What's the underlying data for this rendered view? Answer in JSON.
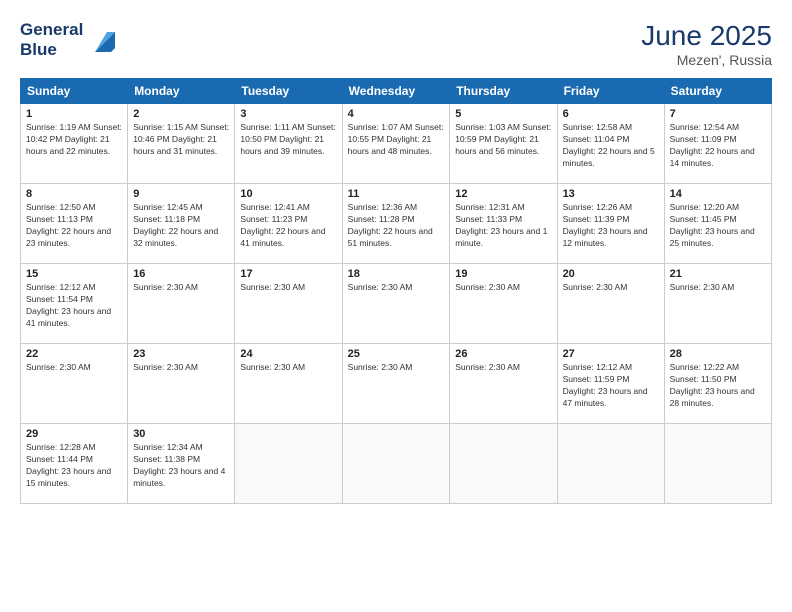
{
  "header": {
    "logo_line1": "General",
    "logo_line2": "Blue",
    "month_year": "June 2025",
    "location": "Mezen', Russia"
  },
  "weekdays": [
    "Sunday",
    "Monday",
    "Tuesday",
    "Wednesday",
    "Thursday",
    "Friday",
    "Saturday"
  ],
  "weeks": [
    [
      {
        "day": "1",
        "info": "Sunrise: 1:19 AM\nSunset: 10:42 PM\nDaylight: 21 hours\nand 22 minutes."
      },
      {
        "day": "2",
        "info": "Sunrise: 1:15 AM\nSunset: 10:46 PM\nDaylight: 21 hours\nand 31 minutes."
      },
      {
        "day": "3",
        "info": "Sunrise: 1:11 AM\nSunset: 10:50 PM\nDaylight: 21 hours\nand 39 minutes."
      },
      {
        "day": "4",
        "info": "Sunrise: 1:07 AM\nSunset: 10:55 PM\nDaylight: 21 hours\nand 48 minutes."
      },
      {
        "day": "5",
        "info": "Sunrise: 1:03 AM\nSunset: 10:59 PM\nDaylight: 21 hours\nand 56 minutes."
      },
      {
        "day": "6",
        "info": "Sunrise: 12:58 AM\nSunset: 11:04 PM\nDaylight: 22 hours\nand 5 minutes."
      },
      {
        "day": "7",
        "info": "Sunrise: 12:54 AM\nSunset: 11:09 PM\nDaylight: 22 hours\nand 14 minutes."
      }
    ],
    [
      {
        "day": "8",
        "info": "Sunrise: 12:50 AM\nSunset: 11:13 PM\nDaylight: 22 hours\nand 23 minutes."
      },
      {
        "day": "9",
        "info": "Sunrise: 12:45 AM\nSunset: 11:18 PM\nDaylight: 22 hours\nand 32 minutes."
      },
      {
        "day": "10",
        "info": "Sunrise: 12:41 AM\nSunset: 11:23 PM\nDaylight: 22 hours\nand 41 minutes."
      },
      {
        "day": "11",
        "info": "Sunrise: 12:36 AM\nSunset: 11:28 PM\nDaylight: 22 hours\nand 51 minutes."
      },
      {
        "day": "12",
        "info": "Sunrise: 12:31 AM\nSunset: 11:33 PM\nDaylight: 23 hours\nand 1 minute."
      },
      {
        "day": "13",
        "info": "Sunrise: 12:26 AM\nSunset: 11:39 PM\nDaylight: 23 hours\nand 12 minutes."
      },
      {
        "day": "14",
        "info": "Sunrise: 12:20 AM\nSunset: 11:45 PM\nDaylight: 23 hours\nand 25 minutes."
      }
    ],
    [
      {
        "day": "15",
        "info": "Sunrise: 12:12 AM\nSunset: 11:54 PM\nDaylight: 23 hours\nand 41 minutes."
      },
      {
        "day": "16",
        "info": "Sunrise: 2:30 AM"
      },
      {
        "day": "17",
        "info": "Sunrise: 2:30 AM"
      },
      {
        "day": "18",
        "info": "Sunrise: 2:30 AM"
      },
      {
        "day": "19",
        "info": "Sunrise: 2:30 AM"
      },
      {
        "day": "20",
        "info": "Sunrise: 2:30 AM"
      },
      {
        "day": "21",
        "info": "Sunrise: 2:30 AM"
      }
    ],
    [
      {
        "day": "22",
        "info": "Sunrise: 2:30 AM"
      },
      {
        "day": "23",
        "info": "Sunrise: 2:30 AM"
      },
      {
        "day": "24",
        "info": "Sunrise: 2:30 AM"
      },
      {
        "day": "25",
        "info": "Sunrise: 2:30 AM"
      },
      {
        "day": "26",
        "info": "Sunrise: 2:30 AM"
      },
      {
        "day": "27",
        "info": "Sunrise: 12:12 AM\nSunset: 11:59 PM\nDaylight: 23 hours\nand 47 minutes."
      },
      {
        "day": "28",
        "info": "Sunrise: 12:22 AM\nSunset: 11:50 PM\nDaylight: 23 hours\nand 28 minutes."
      }
    ],
    [
      {
        "day": "29",
        "info": "Sunrise: 12:28 AM\nSunset: 11:44 PM\nDaylight: 23 hours\nand 15 minutes."
      },
      {
        "day": "30",
        "info": "Sunrise: 12:34 AM\nSunset: 11:38 PM\nDaylight: 23 hours\nand 4 minutes."
      },
      {
        "day": "",
        "info": ""
      },
      {
        "day": "",
        "info": ""
      },
      {
        "day": "",
        "info": ""
      },
      {
        "day": "",
        "info": ""
      },
      {
        "day": "",
        "info": ""
      }
    ]
  ]
}
